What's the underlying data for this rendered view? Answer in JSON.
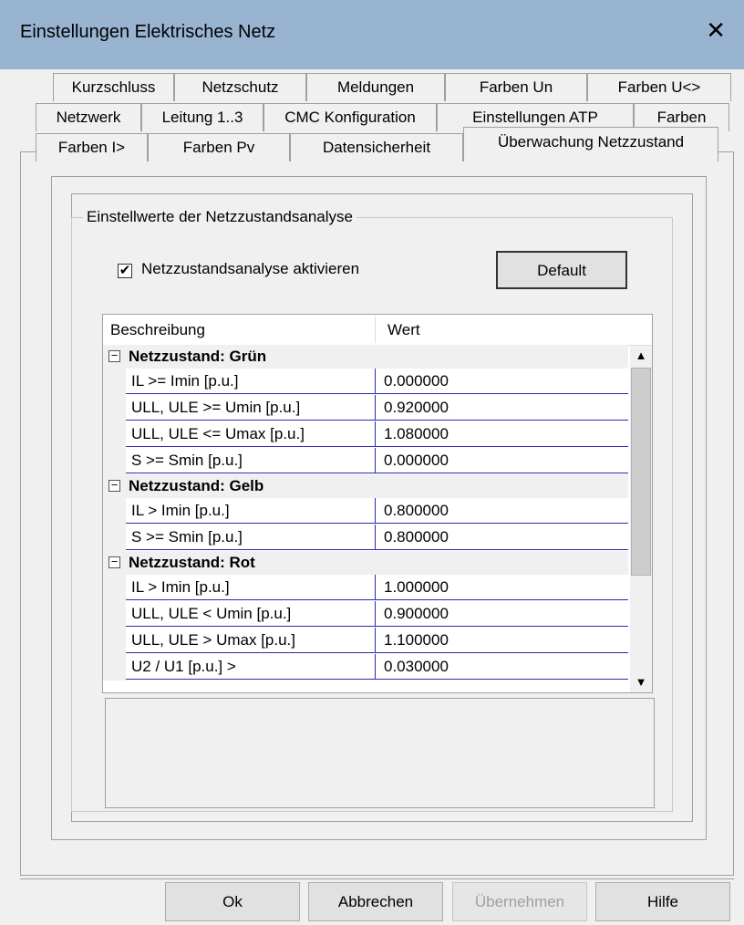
{
  "window": {
    "title": "Einstellungen Elektrisches Netz",
    "close_glyph": "✕"
  },
  "tabs": {
    "row1": [
      "Kurzschluss",
      "Netzschutz",
      "Meldungen",
      "Farben Un",
      "Farben U<>"
    ],
    "row2": [
      "Netzwerk",
      "Leitung 1..3",
      "CMC Konfiguration",
      "Einstellungen ATP",
      "Farben"
    ],
    "row3": [
      "Farben I>",
      "Farben Pv",
      "Datensicherheit",
      "Überwachung Netzzustand"
    ],
    "active": "Überwachung Netzzustand"
  },
  "group": {
    "legend": "Einstellwerte der Netzzustandsanalyse",
    "checkbox_label": "Netzzustandsanalyse aktivieren",
    "checkbox_checked": true,
    "checkbox_glyph": "✔",
    "default_button": "Default"
  },
  "grid": {
    "headers": {
      "description": "Beschreibung",
      "value": "Wert"
    },
    "expander_glyph": "−",
    "groups": [
      {
        "label": "Netzzustand: Grün",
        "rows": [
          {
            "desc": "IL >= Imin [p.u.]",
            "value": "0.000000"
          },
          {
            "desc": "ULL, ULE >= Umin [p.u.]",
            "value": "0.920000"
          },
          {
            "desc": "ULL, ULE <= Umax [p.u.]",
            "value": "1.080000"
          },
          {
            "desc": "S >= Smin [p.u.]",
            "value": "0.000000"
          }
        ]
      },
      {
        "label": "Netzzustand: Gelb",
        "rows": [
          {
            "desc": "IL > Imin [p.u.]",
            "value": "0.800000"
          },
          {
            "desc": "S >= Smin [p.u.]",
            "value": "0.800000"
          }
        ]
      },
      {
        "label": "Netzzustand: Rot",
        "rows": [
          {
            "desc": "IL > Imin [p.u.]",
            "value": "1.000000"
          },
          {
            "desc": "ULL, ULE < Umin [p.u.]",
            "value": "0.900000"
          },
          {
            "desc": "ULL, ULE > Umax [p.u.]",
            "value": "1.100000"
          },
          {
            "desc": "U2 / U1  [p.u.] >",
            "value": "0.030000"
          }
        ]
      }
    ],
    "scroll_up_glyph": "▲",
    "scroll_down_glyph": "▼"
  },
  "footer": {
    "ok": "Ok",
    "cancel": "Abbrechen",
    "apply": "Übernehmen",
    "apply_disabled": true,
    "help": "Hilfe"
  }
}
